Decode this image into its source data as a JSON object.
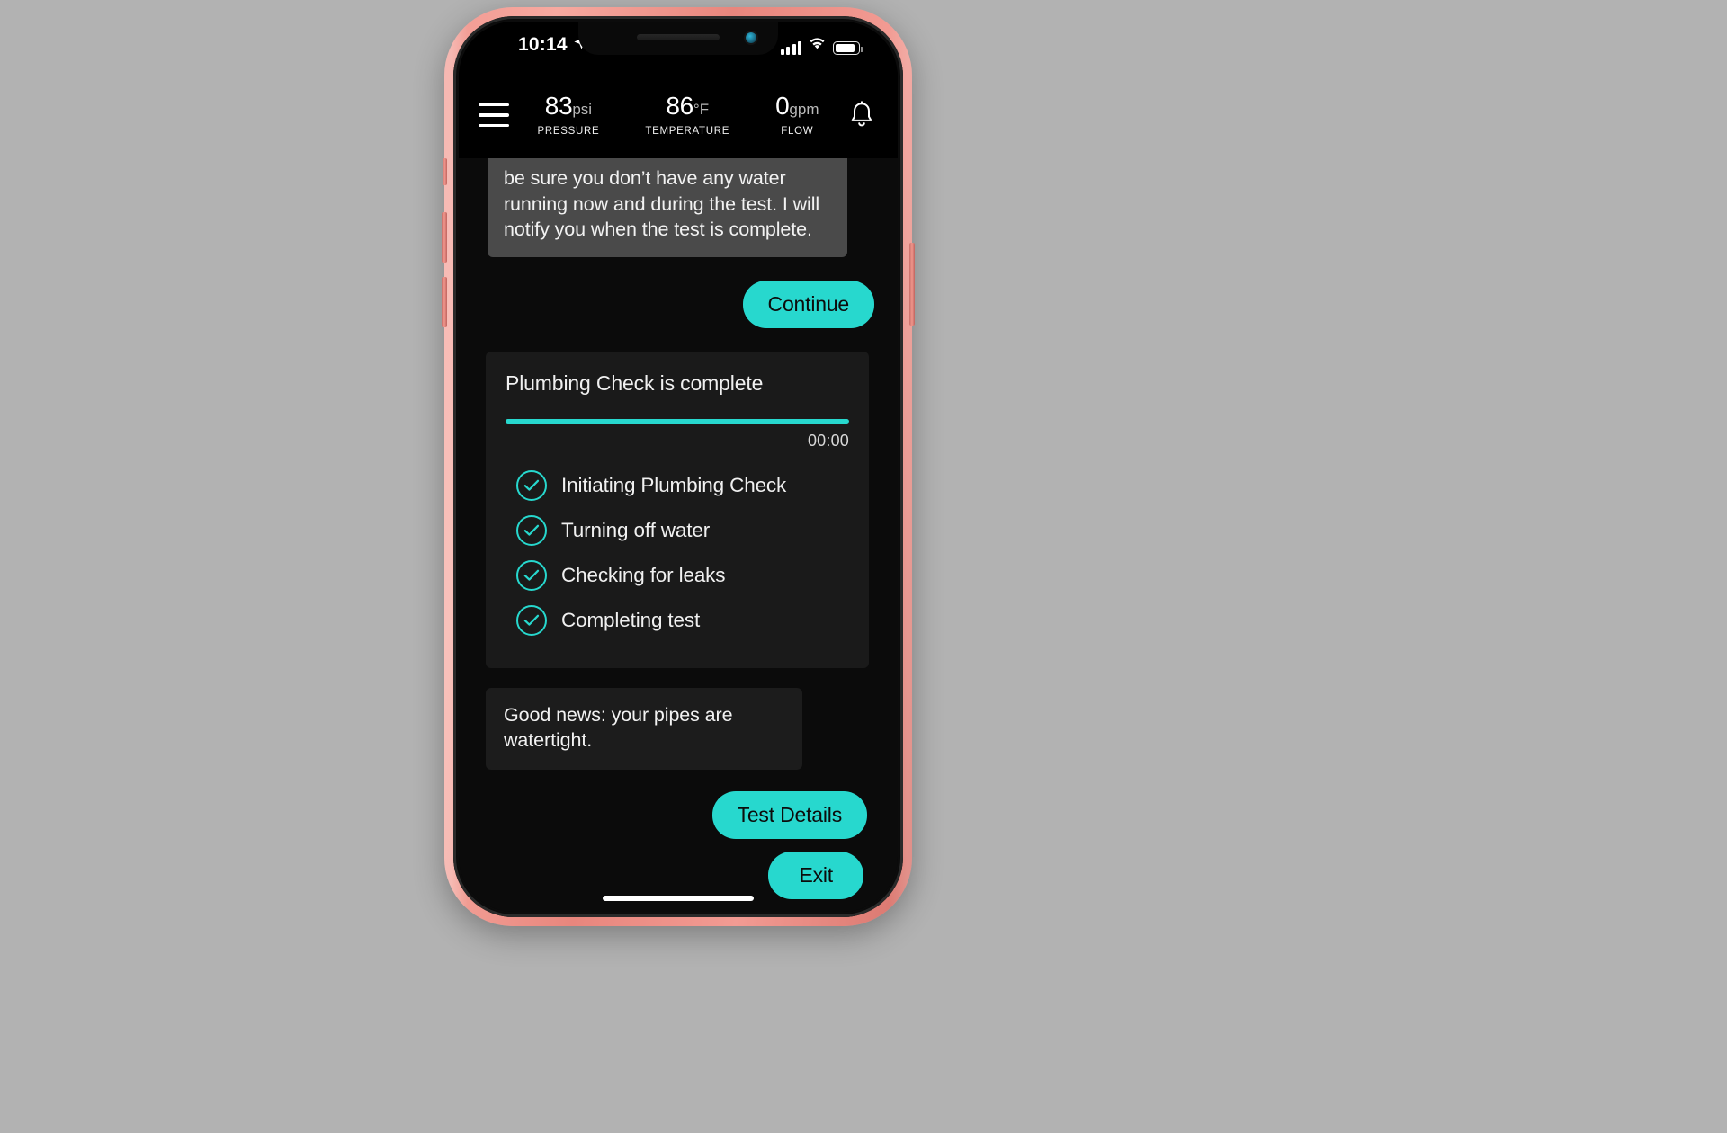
{
  "device": {
    "name": "iphone-xr",
    "case_color": "#ef9890"
  },
  "status_bar": {
    "time": "10:14",
    "location_icon": "location-arrow-icon",
    "signal_icon": "cellular-signal-icon",
    "wifi_icon": "wifi-icon",
    "battery_icon": "battery-icon"
  },
  "header": {
    "menu_icon": "hamburger-menu-icon",
    "bell_icon": "notification-bell-icon",
    "metrics": [
      {
        "value": "83",
        "unit": "psi",
        "label": "PRESSURE"
      },
      {
        "value": "86",
        "unit": "°F",
        "label": "TEMPERATURE"
      },
      {
        "value": "0",
        "unit": "gpm",
        "label": "FLOW"
      }
    ]
  },
  "chat": {
    "message_top": "be sure you don’t have any water running now and during the test. I will notify you when the test is complete.",
    "continue_button": "Continue",
    "progress": {
      "title": "Plumbing Check is complete",
      "percent": 100,
      "elapsed": "00:00",
      "steps": [
        {
          "label": "Initiating Plumbing Check",
          "done": true
        },
        {
          "label": "Turning off water",
          "done": true
        },
        {
          "label": "Checking for leaks",
          "done": true
        },
        {
          "label": "Completing test",
          "done": true
        }
      ]
    },
    "message_result": "Good news: your pipes are watertight.",
    "test_details_button": "Test Details",
    "exit_button": "Exit"
  },
  "colors": {
    "accent": "#27d8ce",
    "screen_bg": "#0b0b0b",
    "bubble_in": "#4a4a4a",
    "card_bg": "#1a1a1a"
  }
}
